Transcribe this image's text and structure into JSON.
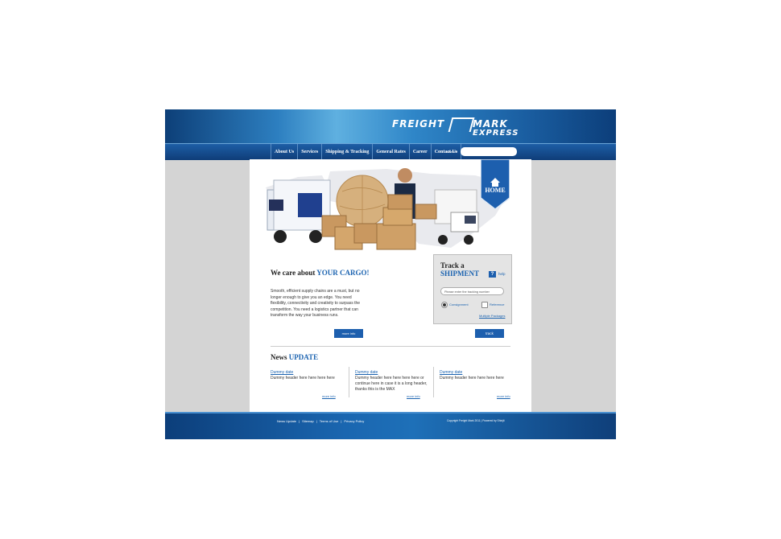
{
  "brand": {
    "name_left": "FREIGHT",
    "name_right": "MARK",
    "sub": "EXPRESS"
  },
  "nav": {
    "items": [
      "About Us",
      "Services",
      "Shipping & Tracking",
      "General Rates",
      "Career",
      "Contact Us"
    ],
    "search_label": "search"
  },
  "home_badge": "HOME",
  "intro": {
    "title_a": "We care about ",
    "title_b": "YOUR CARGO!",
    "body": "Smooth, efficient supply chains are a must, but no longer enough to give you an edge. You need flexibility, connectivity and creativity to surpass the competition. You need a logistics partner that can transform the way your business runs.",
    "more_label": "more info"
  },
  "track": {
    "title_a": "Track a",
    "title_b": "SHIPMENT",
    "help_icon": "?",
    "help_label": "help",
    "input_placeholder": "Please enter the tracking number",
    "opt1": "Consignment",
    "opt2": "Reference",
    "multiple": "Multiple Packages",
    "button": "track"
  },
  "news": {
    "title_a": "News ",
    "title_b": "UPDATE",
    "items": [
      {
        "date": "Dummy date",
        "header": "Dummy header here here here here",
        "more": "more info"
      },
      {
        "date": "Dummy date",
        "header": "Dummy header here here here here or continue here in case it is a long header, thanks this is the MAX",
        "more": "more info"
      },
      {
        "date": "Dummy date",
        "header": "Dummy header here here here here",
        "more": "more info"
      }
    ]
  },
  "footer": {
    "links": [
      "News Update",
      "Sitemap",
      "Terms of Use",
      "Privacy Policy"
    ],
    "copyright": "Copyright Freight Mark 2011   |   Powered by Shinjit"
  },
  "colors": {
    "accent": "#1b63b0",
    "header_dark": "#0d3f78",
    "button": "#1d5fae"
  }
}
